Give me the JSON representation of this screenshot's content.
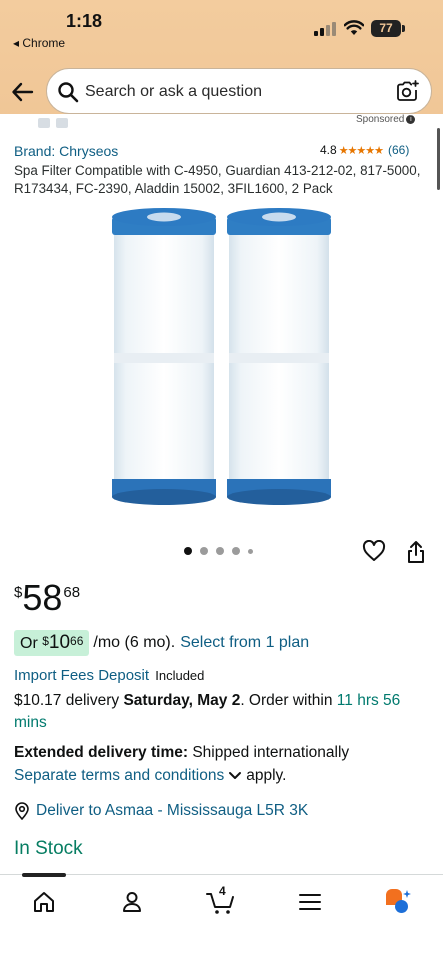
{
  "status_bar": {
    "time": "1:18",
    "back_app": "◂ Chrome",
    "battery": "77"
  },
  "search": {
    "placeholder": "Search or ask a question"
  },
  "sponsored_label": "Sponsored",
  "product": {
    "brand": "Brand: Chryseos",
    "rating_value": "4.8",
    "rating_stars": "★★★★★",
    "rating_count": "(66)",
    "title": "Spa Filter Compatible with C-4950, Guardian 413-212-02, 817-5000, R173434, FC-2390, Aladdin 15002, 3FIL1600, 2 Pack",
    "image_pages": 5,
    "image_active": 0
  },
  "price": {
    "currency": "$",
    "whole": "58",
    "fraction": "68"
  },
  "installment": {
    "prefix": "Or ",
    "currency": "$",
    "whole": "10",
    "fraction": "66",
    "period": "/mo (6 mo).",
    "link": "Select from 1 plan"
  },
  "import_fees": {
    "link": "Import Fees Deposit",
    "status": "Included"
  },
  "delivery": {
    "price": "$10.17 delivery ",
    "date": "Saturday, May 2",
    "order_within_prefix": ". Order within ",
    "countdown": "11 hrs 56 mins"
  },
  "extended": {
    "label": "Extended delivery time:",
    "text": " Shipped internationally"
  },
  "terms": {
    "link": "Separate terms and conditions",
    "suffix": "apply."
  },
  "deliver_to": "Deliver to Asmaa - Mississauga L5R 3K",
  "stock": "In Stock",
  "tabbar": {
    "cart_count": "4",
    "tabs": [
      "home-icon",
      "account-icon",
      "cart-icon",
      "menu-icon",
      "rufus-icon"
    ]
  },
  "colors": {
    "header_bg": "#f0c696",
    "link": "#0f5e83",
    "in_stock": "#067d62",
    "installment_chip": "#c7f0d8",
    "star": "#e77600"
  }
}
